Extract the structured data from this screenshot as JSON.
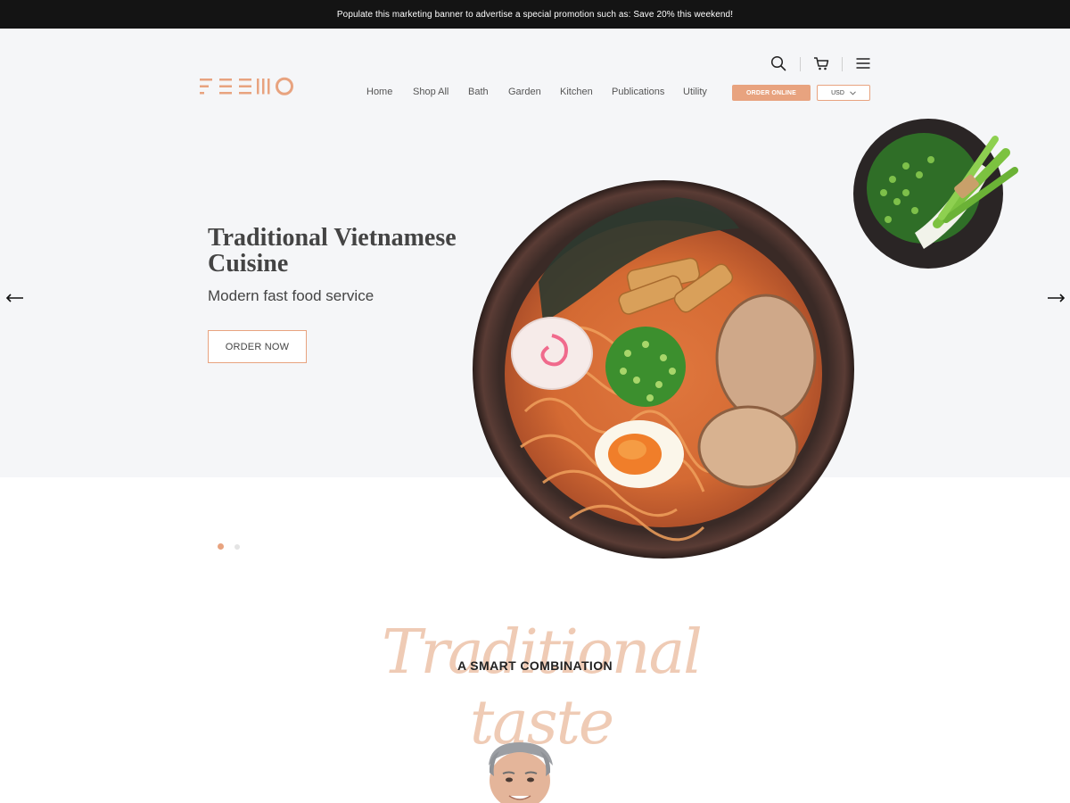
{
  "promo": {
    "text": "Populate this marketing banner to advertise a special promotion such as: Save 20% this weekend!"
  },
  "brand": {
    "logo_text": "FEEMO",
    "accent": "#e8a37f",
    "dark": "#141414",
    "hero_bg": "#f5f6f8"
  },
  "header": {
    "icons": [
      "search-icon",
      "cart-icon",
      "menu-icon"
    ],
    "nav": [
      {
        "label": "Home"
      },
      {
        "label": "Shop All"
      },
      {
        "label": "Bath"
      },
      {
        "label": "Garden"
      },
      {
        "label": "Kitchen"
      },
      {
        "label": "Publications"
      },
      {
        "label": "Utility"
      }
    ],
    "order_online": "ORDER ONLINE",
    "currency": "USD"
  },
  "hero": {
    "title": "Traditional Vietnamese Cuisine",
    "subtitle": "Modern fast food service",
    "cta": "ORDER NOW",
    "slide_count": 2,
    "active_slide": 1
  },
  "section": {
    "script_text": "Traditional taste",
    "title": "A SMART COMBINATION"
  }
}
